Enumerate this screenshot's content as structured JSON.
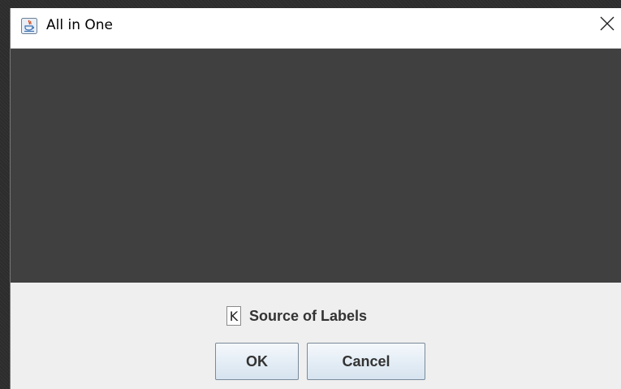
{
  "window": {
    "title": "All in One",
    "app_icon": "java-cup-icon",
    "close_icon": "close-icon"
  },
  "options": {
    "source_of_labels": {
      "checkbox_glyph": "K",
      "label": "Source of Labels"
    }
  },
  "buttons": {
    "ok_label": "OK",
    "cancel_label": "Cancel"
  },
  "colors": {
    "content_area": "#404040",
    "dialog_background": "#efefef",
    "title_bar": "#ffffff"
  }
}
